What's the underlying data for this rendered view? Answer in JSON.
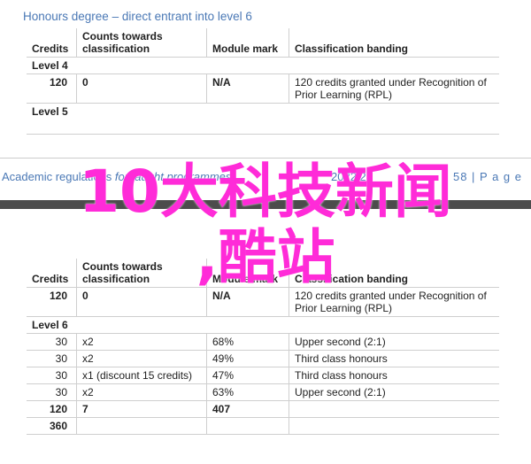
{
  "page_top": {
    "heading": "Honours degree – direct entrant into level 6",
    "headers": [
      "Credits",
      "Counts towards classification",
      "Module mark",
      "Classification banding"
    ],
    "level4_label": "Level 4",
    "level4_row": {
      "credits": "120",
      "counts": "0",
      "mark": "N/A",
      "banding": "120 credits granted under Recognition of Prior Learning (RPL)"
    },
    "level5_label": "Level 5"
  },
  "footer": {
    "left_regular": "Academic regulations",
    "left_italic": " for taught programmes",
    "mid": "2022/23",
    "page": "58 | P a g e"
  },
  "page_bottom": {
    "headers": [
      "Credits",
      "Counts towards classification",
      "Module mark",
      "Classification banding"
    ],
    "level5_row": {
      "credits": "120",
      "counts": "0",
      "mark": "N/A",
      "banding": "120 credits granted under Recognition of Prior Learning (RPL)"
    },
    "level6_label": "Level 6",
    "rows": [
      {
        "credits": "30",
        "counts": "x2",
        "mark": "68%",
        "banding": "Upper second (2:1)"
      },
      {
        "credits": "30",
        "counts": "x2",
        "mark": "49%",
        "banding": "Third class honours"
      },
      {
        "credits": "30",
        "counts": "x1 (discount 15 credits)",
        "mark": "47%",
        "banding": "Third class honours"
      },
      {
        "credits": "30",
        "counts": "x2",
        "mark": "63%",
        "banding": "Upper second (2:1)"
      }
    ],
    "total_row": {
      "credits": "120",
      "counts": "7",
      "mark": "407"
    },
    "grand_total": "360"
  },
  "watermark": {
    "line1": "10大科技新闻",
    "line2": ",酷站"
  },
  "colors": {
    "heading": "#4a78b5",
    "watermark": "#ff2bd8",
    "bar": "#4c4c4c"
  }
}
